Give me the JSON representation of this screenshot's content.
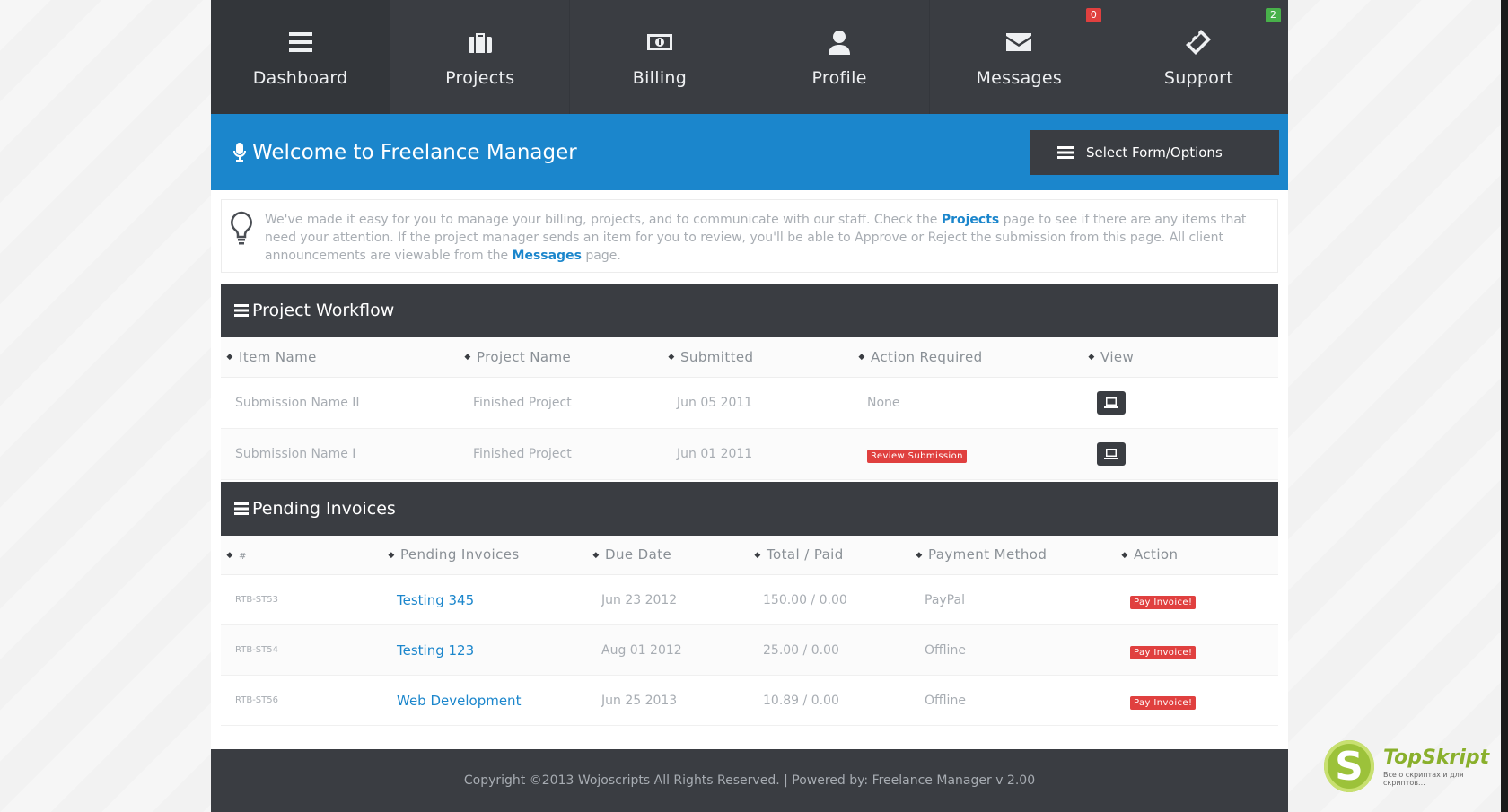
{
  "nav": {
    "items": [
      {
        "label": "Dashboard",
        "icon": "menu-icon"
      },
      {
        "label": "Projects",
        "icon": "briefcase-icon"
      },
      {
        "label": "Billing",
        "icon": "money-icon"
      },
      {
        "label": "Profile",
        "icon": "user-icon"
      },
      {
        "label": "Messages",
        "icon": "envelope-icon",
        "badge": "0"
      },
      {
        "label": "Support",
        "icon": "ticket-icon",
        "badge": "2"
      }
    ]
  },
  "banner": {
    "title": "Welcome to Freelance Manager",
    "select_label": "Select Form/Options"
  },
  "info": {
    "part1": "We've made it easy for you to manage your billing, projects, and to communicate with our staff. Check the ",
    "link1": "Projects",
    "part2": " page to see if there are any items that need your attention. If the project manager sends an item for you to review, you'll be able to Approve or Reject the submission from this page. All client announcements are viewable from the ",
    "link2": "Messages",
    "part3": " page."
  },
  "workflow": {
    "title": "Project Workflow",
    "columns": [
      "Item Name",
      "Project Name",
      "Submitted",
      "Action Required",
      "View"
    ],
    "rows": [
      {
        "item": "Submission Name II",
        "project": "Finished Project",
        "submitted": "Jun 05 2011",
        "action": "None"
      },
      {
        "item": "Submission Name I",
        "project": "Finished Project",
        "submitted": "Jun 01 2011",
        "action": "Review Submission"
      }
    ]
  },
  "invoices": {
    "title": "Pending Invoices",
    "columns": [
      "#",
      "Pending Invoices",
      "Due Date",
      "Total / Paid",
      "Payment Method",
      "Action"
    ],
    "rows": [
      {
        "id": "RTB-ST53",
        "name": "Testing 345",
        "due": "Jun 23 2012",
        "total": "150.00 / 0.00",
        "method": "PayPal",
        "action": "Pay Invoice!"
      },
      {
        "id": "RTB-ST54",
        "name": "Testing 123",
        "due": "Aug 01 2012",
        "total": "25.00 / 0.00",
        "method": "Offline",
        "action": "Pay Invoice!"
      },
      {
        "id": "RTB-ST56",
        "name": "Web Development",
        "due": "Jun 25 2013",
        "total": "10.89 / 0.00",
        "method": "Offline",
        "action": "Pay Invoice!"
      }
    ]
  },
  "footer": {
    "text": "Copyright ©2013 Wojoscripts All Rights Reserved. | Powered by: Freelance Manager v 2.00"
  },
  "watermark": {
    "logo_letter": "S",
    "name": "TopSkript",
    "sub": "Все о скриптах и для скриптов..."
  },
  "colors": {
    "dark": "#3a3d42",
    "accent": "#1b86cc",
    "danger": "#e0403f",
    "success": "#48b14a"
  }
}
